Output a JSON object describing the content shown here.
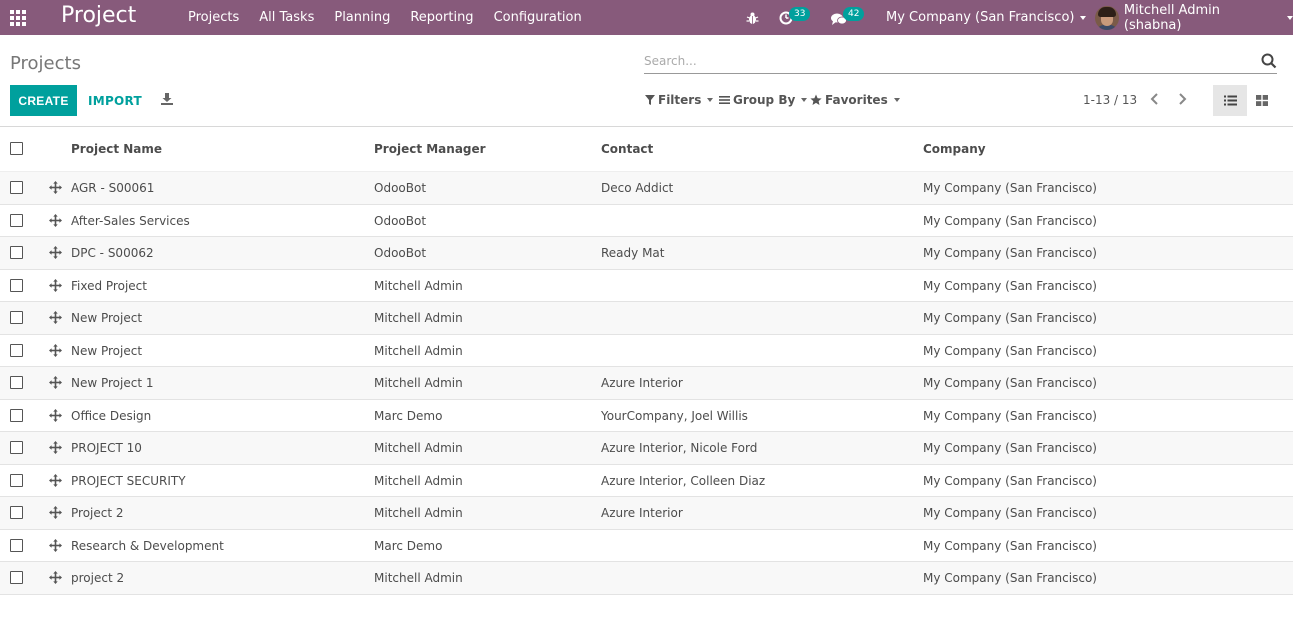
{
  "navbar": {
    "app_name": "Project",
    "menu": [
      "Projects",
      "All Tasks",
      "Planning",
      "Reporting",
      "Configuration"
    ],
    "activity_count": "33",
    "messages_count": "42",
    "company": "My Company (San Francisco)",
    "user": "Mitchell Admin (shabna)",
    "brand_color": "#875a7b"
  },
  "control_panel": {
    "breadcrumb": "Projects",
    "create_label": "CREATE",
    "import_label": "IMPORT",
    "search_placeholder": "Search...",
    "filters_label": "Filters",
    "groupby_label": "Group By",
    "favorites_label": "Favorites",
    "pager": "1-13 / 13",
    "accent_color": "#00a09d"
  },
  "table": {
    "columns": [
      "Project Name",
      "Project Manager",
      "Contact",
      "Company"
    ],
    "rows": [
      {
        "name": "AGR - S00061",
        "manager": "OdooBot",
        "contact": "Deco Addict",
        "company": "My Company (San Francisco)"
      },
      {
        "name": "After-Sales Services",
        "manager": "OdooBot",
        "contact": "",
        "company": "My Company (San Francisco)"
      },
      {
        "name": "DPC - S00062",
        "manager": "OdooBot",
        "contact": "Ready Mat",
        "company": "My Company (San Francisco)"
      },
      {
        "name": "Fixed Project",
        "manager": "Mitchell Admin",
        "contact": "",
        "company": "My Company (San Francisco)"
      },
      {
        "name": "New Project",
        "manager": "Mitchell Admin",
        "contact": "",
        "company": "My Company (San Francisco)"
      },
      {
        "name": "New Project",
        "manager": "Mitchell Admin",
        "contact": "",
        "company": "My Company (San Francisco)"
      },
      {
        "name": "New Project 1",
        "manager": "Mitchell Admin",
        "contact": "Azure Interior",
        "company": "My Company (San Francisco)"
      },
      {
        "name": "Office Design",
        "manager": "Marc Demo",
        "contact": "YourCompany, Joel Willis",
        "company": "My Company (San Francisco)"
      },
      {
        "name": "PROJECT 10",
        "manager": "Mitchell Admin",
        "contact": "Azure Interior, Nicole Ford",
        "company": "My Company (San Francisco)"
      },
      {
        "name": "PROJECT SECURITY",
        "manager": "Mitchell Admin",
        "contact": "Azure Interior, Colleen Diaz",
        "company": "My Company (San Francisco)"
      },
      {
        "name": "Project 2",
        "manager": "Mitchell Admin",
        "contact": "Azure Interior",
        "company": "My Company (San Francisco)"
      },
      {
        "name": "Research & Development",
        "manager": "Marc Demo",
        "contact": "",
        "company": "My Company (San Francisco)"
      },
      {
        "name": "project 2",
        "manager": "Mitchell Admin",
        "contact": "",
        "company": "My Company (San Francisco)"
      }
    ]
  }
}
